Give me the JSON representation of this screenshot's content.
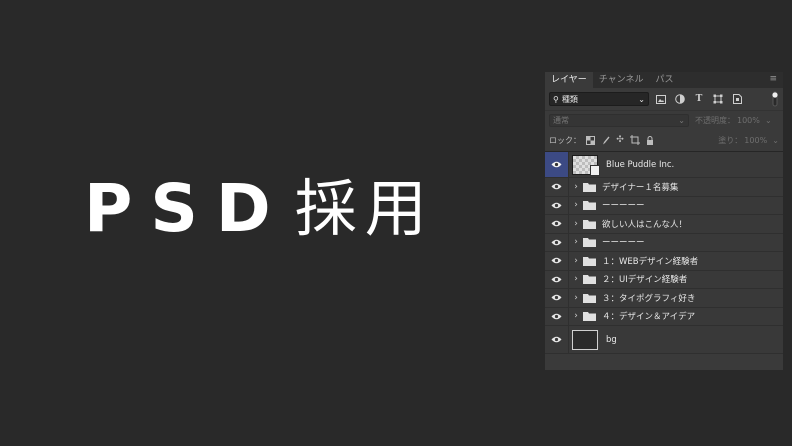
{
  "hero": {
    "psd": "PSD",
    "jp": "採用"
  },
  "panel": {
    "tabs": [
      "レイヤー",
      "チャンネル",
      "パス"
    ],
    "menu_glyph": "≡",
    "filter": {
      "selected": "種類",
      "icons": [
        "image-filter-icon",
        "adjustment-filter-icon",
        "type-filter-icon",
        "shape-filter-icon",
        "smart-object-filter-icon"
      ]
    },
    "blend": {
      "selected": "通常",
      "opacity_label": "不透明度：",
      "opacity_value": "100%"
    },
    "lock": {
      "label": "ロック：",
      "fill_label": "塗り：",
      "fill_value": "100%"
    }
  },
  "layers": [
    {
      "name": "Blue Puddle Inc.",
      "kind": "smart-object"
    },
    {
      "name": "デザイナー１名募集",
      "kind": "group"
    },
    {
      "name": "ーーーーー",
      "kind": "group"
    },
    {
      "name": "欲しい人はこんな人！",
      "kind": "group"
    },
    {
      "name": "ーーーーー",
      "kind": "group"
    },
    {
      "name": "１：WEBデザイン経験者",
      "kind": "group"
    },
    {
      "name": "２：UIデザイン経験者",
      "kind": "group"
    },
    {
      "name": "３：タイポグラフィ好き",
      "kind": "group"
    },
    {
      "name": "４：デザイン＆アイデア",
      "kind": "group"
    },
    {
      "name": "bg",
      "kind": "pixel"
    }
  ],
  "colors": {
    "background": "#292929",
    "panel": "#3a3a3a",
    "selected_eye": "#3c4a84"
  }
}
